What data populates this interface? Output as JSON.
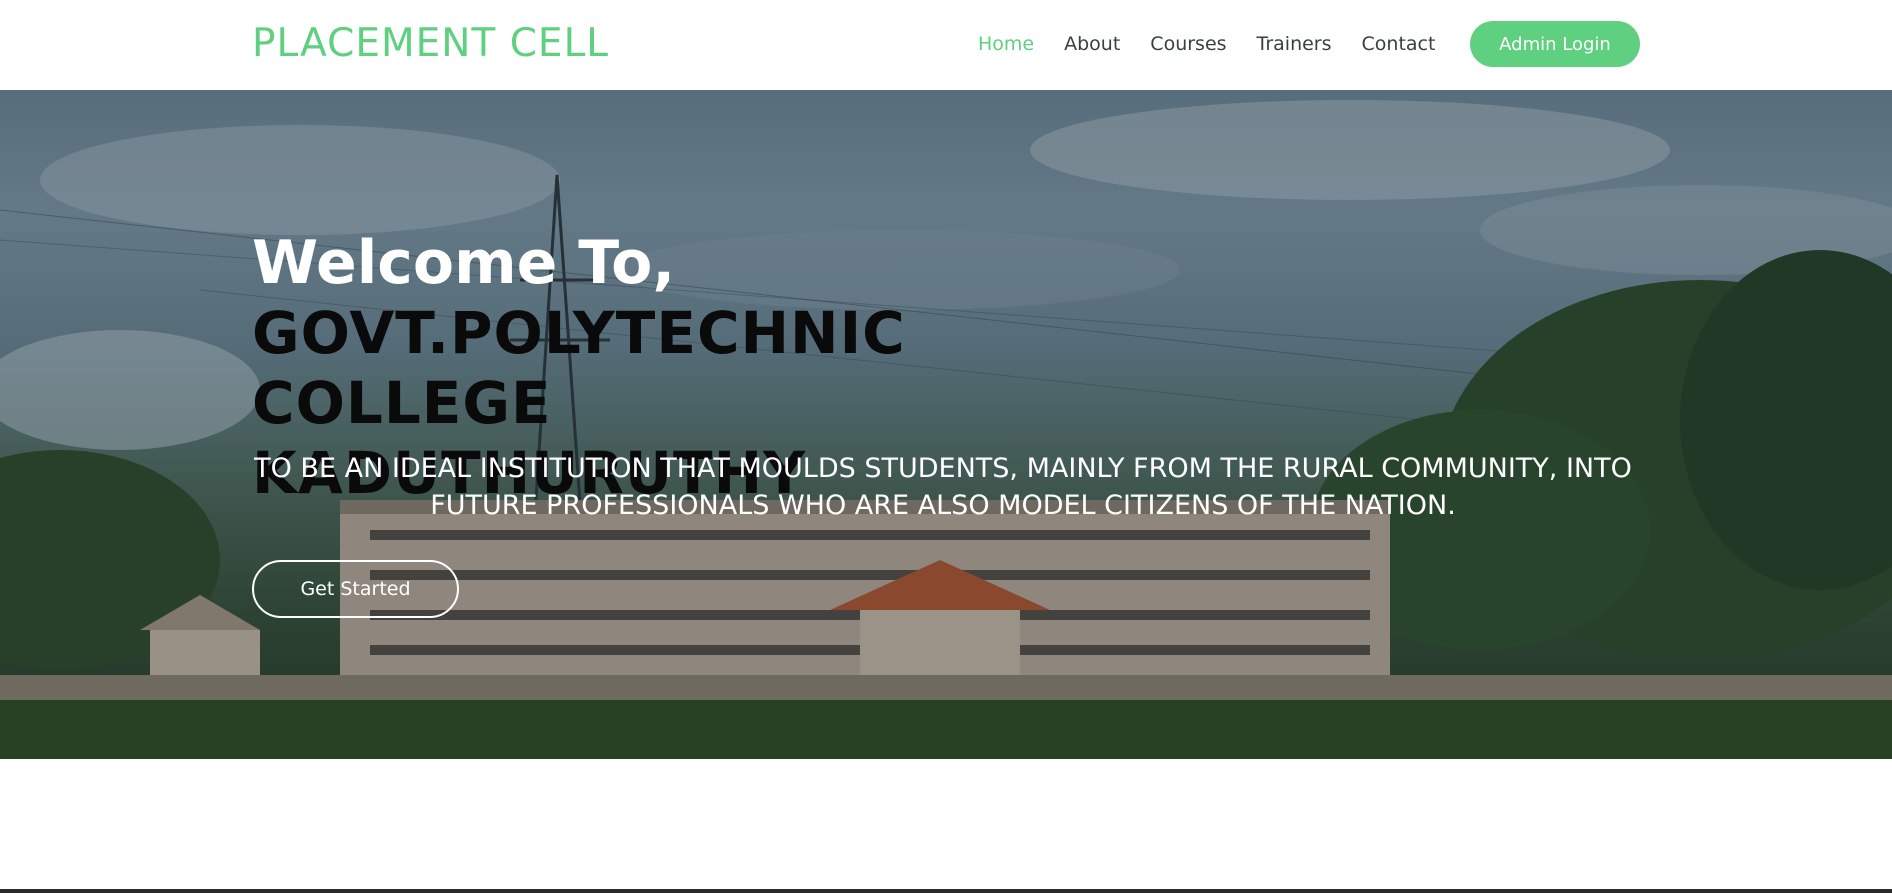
{
  "header": {
    "logo": "PLACEMENT CELL",
    "nav": {
      "home": "Home",
      "about": "About",
      "courses": "Courses",
      "trainers": "Trainers",
      "contact": "Contact"
    },
    "admin_login": "Admin Login"
  },
  "hero": {
    "welcome": "Welcome To,",
    "college_line1": "GOVT.POLYTECHNIC COLLEGE",
    "college_line2": "KADUTHURUTHY",
    "mission": "TO BE AN IDEAL INSTITUTION THAT MOULDS STUDENTS, MAINLY FROM THE RURAL COMMUNITY, INTO FUTURE PROFESSIONALS WHO ARE ALSO MODEL CITIZENS OF THE NATION.",
    "cta": "Get Started"
  },
  "colors": {
    "accent": "#5fcf80",
    "nav_text": "#37423b"
  }
}
